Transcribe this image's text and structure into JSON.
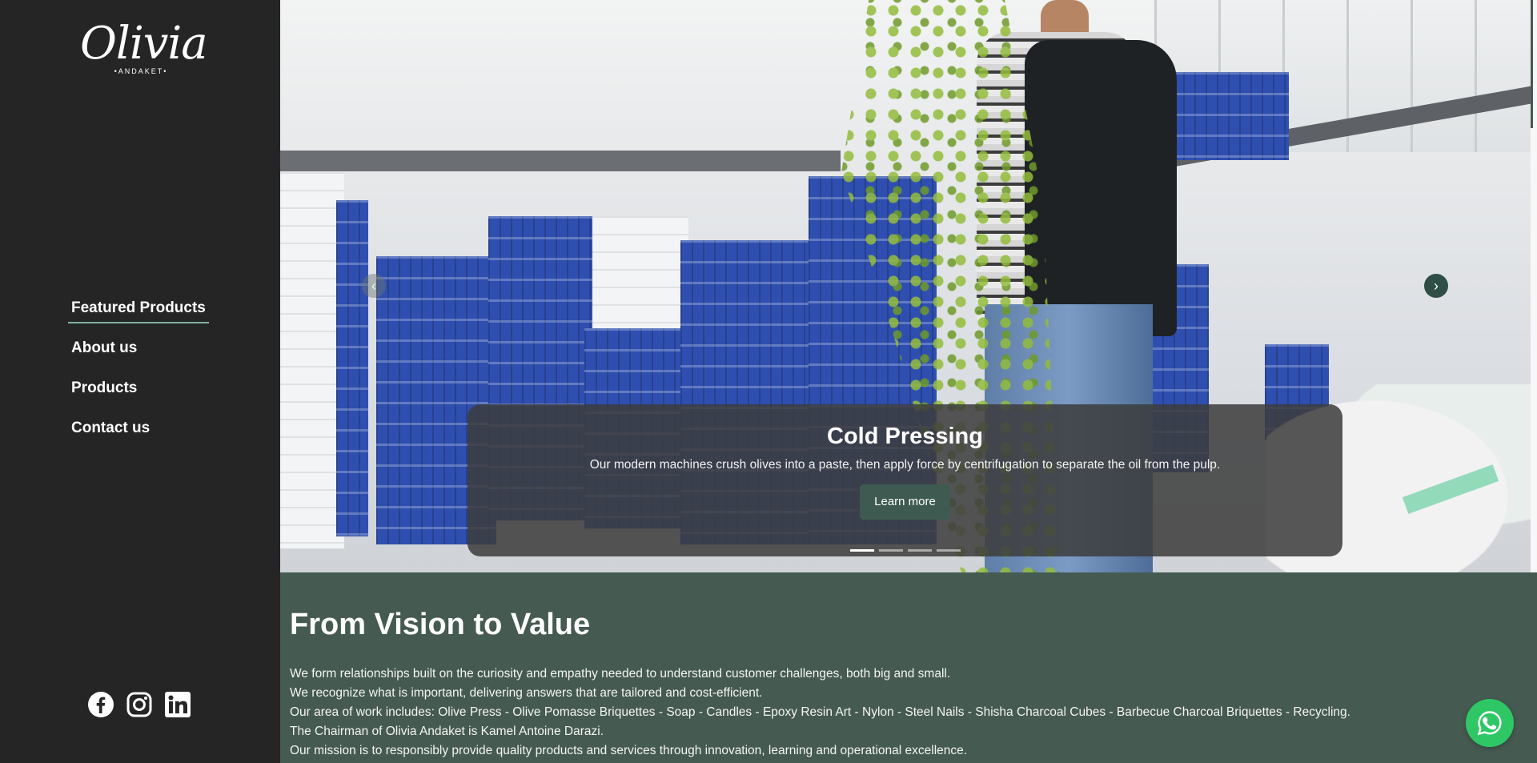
{
  "brand": {
    "logo_script": "Olivia",
    "logo_sub": "•ANDAKET•"
  },
  "nav": {
    "items": [
      {
        "label": "Featured Products",
        "active": true
      },
      {
        "label": "About us"
      },
      {
        "label": "Products"
      },
      {
        "label": "Contact us"
      }
    ]
  },
  "socials": [
    {
      "icon": "facebook-icon"
    },
    {
      "icon": "instagram-icon"
    },
    {
      "icon": "linkedin-icon"
    }
  ],
  "carousel": {
    "prev_glyph": "‹",
    "next_glyph": "›",
    "slide_title": "Cold Pressing",
    "slide_text": "Our modern machines crush olives into a paste, then apply force by centrifugation to separate the oil from the pulp.",
    "cta_label": "Learn more",
    "slide_count": 4,
    "active_slide": 1
  },
  "section": {
    "title": "From Vision to Value",
    "lines": [
      "We form relationships built on the curiosity and empathy needed to understand customer challenges, both big and small.",
      "We recognize what is important, delivering answers that are tailored and cost-efficient.",
      "Our area of work includes: Olive Press - Olive Pomasse Briquettes - Soap - Candles - Epoxy Resin Art - Nylon - Steel Nails - Shisha Charcoal Cubes - Barbecue Charcoal Briquettes - Recycling.",
      "The Chairman of Olivia Andaket is Kamel Antoine Darazi.",
      "Our mission is to responsibly provide quality products and services through innovation, learning and operational excellence."
    ]
  },
  "colors": {
    "sidebar_bg": "#252525",
    "section_bg": "#455a51",
    "accent": "#3f5a50",
    "whatsapp": "#2fc766"
  },
  "floating": {
    "icon": "whatsapp-icon"
  }
}
